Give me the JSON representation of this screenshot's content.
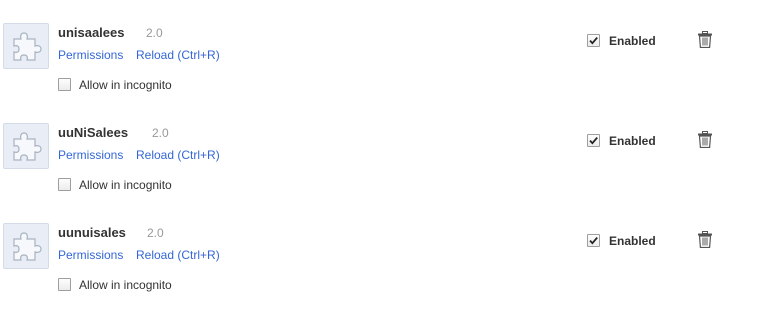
{
  "extensions": [
    {
      "name": "unisaalees",
      "version": "2.0",
      "permissions_label": "Permissions",
      "reload_label": "Reload (Ctrl+R)",
      "incognito_label": "Allow in incognito",
      "incognito_allowed": false,
      "enabled_label": "Enabled",
      "enabled": true
    },
    {
      "name": "uuNiSalees",
      "version": "2.0",
      "permissions_label": "Permissions",
      "reload_label": "Reload (Ctrl+R)",
      "incognito_label": "Allow in incognito",
      "incognito_allowed": false,
      "enabled_label": "Enabled",
      "enabled": true
    },
    {
      "name": "uunuisales",
      "version": "2.0",
      "permissions_label": "Permissions",
      "reload_label": "Reload (Ctrl+R)",
      "incognito_label": "Allow in incognito",
      "incognito_allowed": false,
      "enabled_label": "Enabled",
      "enabled": true
    }
  ],
  "icons": {
    "extension": "puzzle-piece-icon",
    "remove": "trash-icon",
    "checked": "checkmark-icon"
  },
  "colors": {
    "link": "#3367d6",
    "icon_bg": "#e9eef6",
    "icon_border": "#d3dbe7",
    "version": "#999999"
  }
}
